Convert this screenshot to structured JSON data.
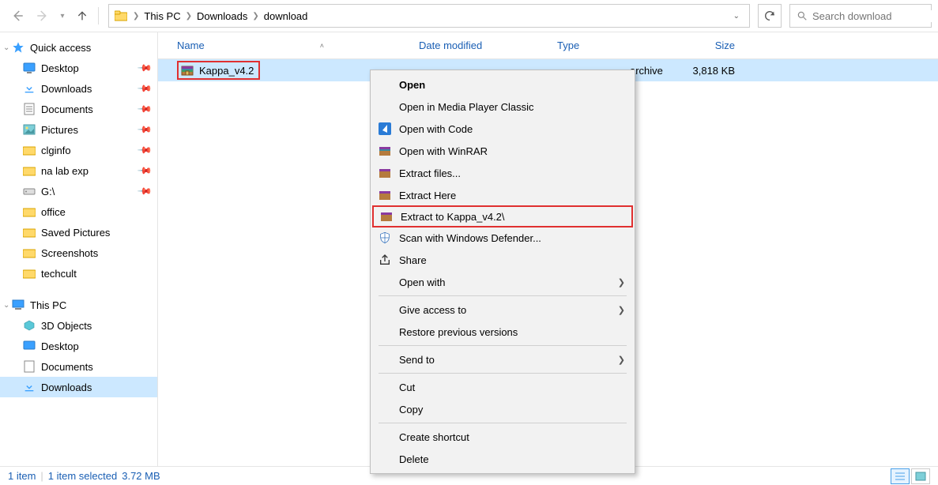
{
  "toolbar": {
    "breadcrumb": [
      "This PC",
      "Downloads",
      "download"
    ],
    "search_placeholder": "Search download"
  },
  "sidebar": {
    "quick_access": {
      "label": "Quick access",
      "items": [
        {
          "label": "Desktop",
          "icon": "desktop",
          "pinned": true
        },
        {
          "label": "Downloads",
          "icon": "downloads",
          "pinned": true
        },
        {
          "label": "Documents",
          "icon": "documents",
          "pinned": true
        },
        {
          "label": "Pictures",
          "icon": "pictures",
          "pinned": true
        },
        {
          "label": "clginfo",
          "icon": "folder",
          "pinned": true
        },
        {
          "label": "na lab exp",
          "icon": "folder",
          "pinned": true
        },
        {
          "label": "G:\\",
          "icon": "drive",
          "pinned": true
        },
        {
          "label": "office",
          "icon": "folder",
          "pinned": false
        },
        {
          "label": "Saved Pictures",
          "icon": "folder",
          "pinned": false
        },
        {
          "label": "Screenshots",
          "icon": "folder",
          "pinned": false
        },
        {
          "label": "techcult",
          "icon": "folder",
          "pinned": false
        }
      ]
    },
    "this_pc": {
      "label": "This PC",
      "items": [
        {
          "label": "3D Objects",
          "icon": "3d"
        },
        {
          "label": "Desktop",
          "icon": "desktop"
        },
        {
          "label": "Documents",
          "icon": "documents"
        },
        {
          "label": "Downloads",
          "icon": "downloads",
          "selected": true
        }
      ]
    }
  },
  "columns": {
    "name": "Name",
    "date": "Date modified",
    "type": "Type",
    "size": "Size"
  },
  "file": {
    "name": "Kappa_v4.2",
    "type_partial": "archive",
    "size": "3,818 KB"
  },
  "context_menu": {
    "open": "Open",
    "open_media": "Open in Media Player Classic",
    "open_code": "Open with Code",
    "open_winrar": "Open with WinRAR",
    "extract_files": "Extract files...",
    "extract_here": "Extract Here",
    "extract_to": "Extract to Kappa_v4.2\\",
    "scan_defender": "Scan with Windows Defender...",
    "share": "Share",
    "open_with": "Open with",
    "give_access": "Give access to",
    "restore_prev": "Restore previous versions",
    "send_to": "Send to",
    "cut": "Cut",
    "copy": "Copy",
    "create_shortcut": "Create shortcut",
    "delete": "Delete"
  },
  "status": {
    "items": "1 item",
    "selected": "1 item selected",
    "size": "3.72 MB"
  }
}
